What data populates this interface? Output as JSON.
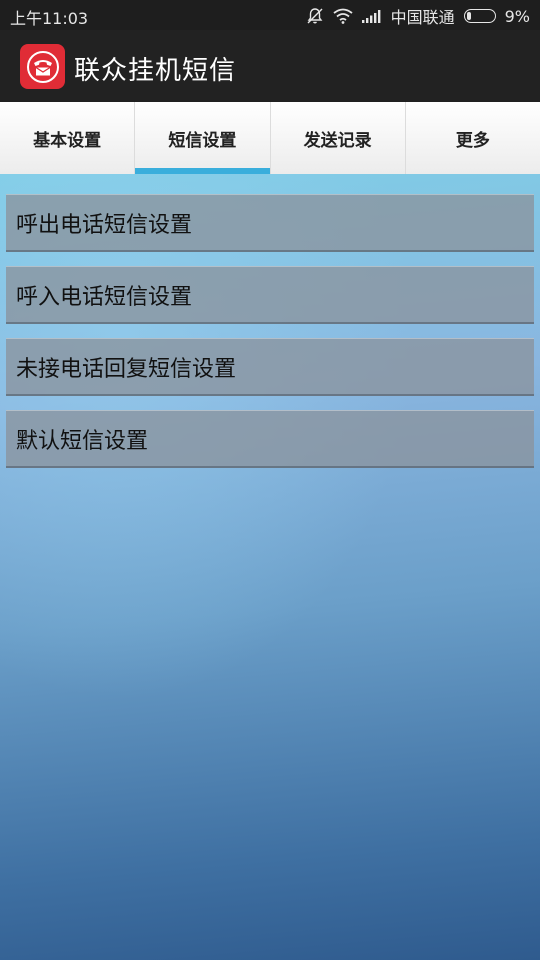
{
  "status_bar": {
    "time": "上午11:03",
    "carrier": "中国联通",
    "battery": "9%",
    "icons": [
      "mute-alarm-icon",
      "wifi-icon",
      "signal-icon",
      "battery-icon"
    ]
  },
  "app_bar": {
    "title": "联众挂机短信",
    "icon": "phone-envelope-icon",
    "icon_color": "#e02c36"
  },
  "tabs": [
    {
      "label": "基本设置",
      "selected": false
    },
    {
      "label": "短信设置",
      "selected": true
    },
    {
      "label": "发送记录",
      "selected": false
    },
    {
      "label": "更多",
      "selected": false
    }
  ],
  "accent_color": "#3aaedc",
  "menu": {
    "items": [
      {
        "label": "呼出电话短信设置"
      },
      {
        "label": "呼入电话短信设置"
      },
      {
        "label": "未接电话回复短信设置"
      },
      {
        "label": "默认短信设置"
      }
    ]
  }
}
